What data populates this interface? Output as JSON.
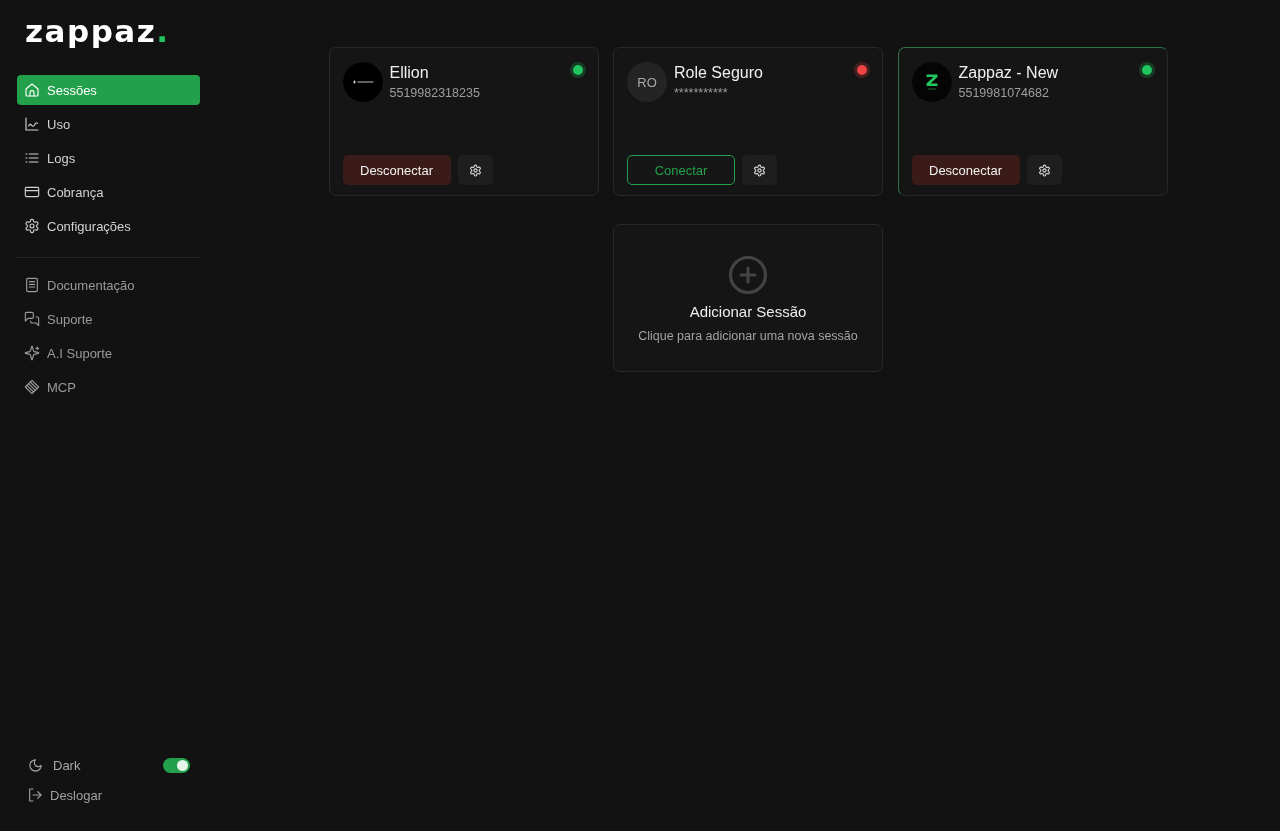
{
  "logo": {
    "name": "zappaz",
    "dot": "."
  },
  "sidebar": {
    "main_items": [
      {
        "label": "Sessões",
        "selected": true
      },
      {
        "label": "Uso",
        "selected": false
      },
      {
        "label": "Logs",
        "selected": false
      },
      {
        "label": "Cobrança",
        "selected": false
      },
      {
        "label": "Configurações",
        "selected": false
      }
    ],
    "help_items": [
      {
        "label": "Documentação",
        "selected": false
      },
      {
        "label": "Suporte",
        "selected": false
      },
      {
        "label": "A.I Suporte",
        "selected": false
      },
      {
        "label": "MCP",
        "selected": false
      }
    ],
    "theme_toggle": {
      "label": "Dark",
      "on": true
    },
    "logout": {
      "label": "Deslogar"
    }
  },
  "sessions": [
    {
      "name": "Ellion",
      "phone": "5519982318235",
      "avatar": {
        "kind": "image"
      },
      "color": "#22c55e",
      "connected": true,
      "highlighted": false,
      "action": "Desconectar"
    },
    {
      "name": "Role Seguro",
      "phone": "***********",
      "avatar": {
        "kind": "initials",
        "initials": "RO"
      },
      "color": "#ef4444",
      "connected": false,
      "highlighted": false,
      "action": "Conectar"
    },
    {
      "name": "Zappaz - New",
      "phone": "5519981074682",
      "avatar": {
        "kind": "image"
      },
      "color": "#22c55e",
      "connected": true,
      "highlighted": true,
      "action": "Desconectar"
    }
  ],
  "add_session": {
    "title": "Adicionar Sessão",
    "subtitle": "Clique para adicionar uma nova sessão"
  }
}
